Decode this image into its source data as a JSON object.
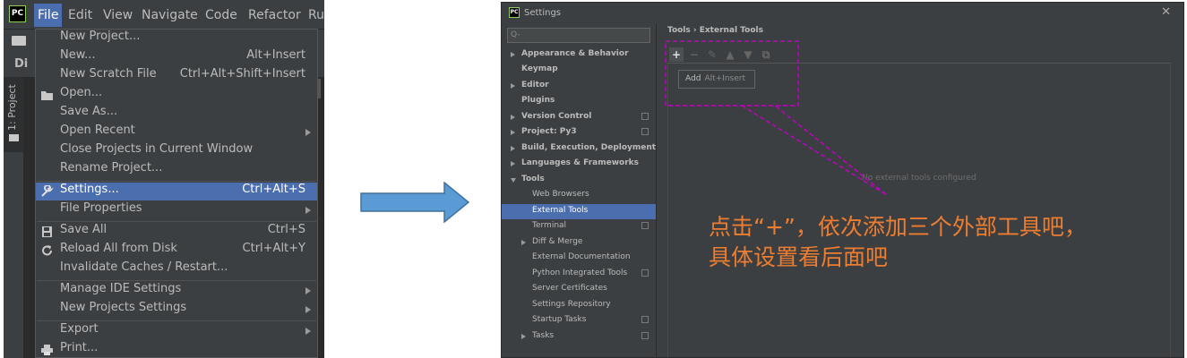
{
  "ide": {
    "logo": "PC",
    "menubar": [
      "File",
      "Edit",
      "View",
      "Navigate",
      "Code",
      "Refactor",
      "Ru"
    ],
    "project_crumb": "Di",
    "project_tab": "1: Project",
    "file_menu": [
      {
        "label": "New Project...",
        "shortcut": ""
      },
      {
        "label": "New...",
        "shortcut": "Alt+Insert"
      },
      {
        "label": "New Scratch File",
        "shortcut": "Ctrl+Alt+Shift+Insert"
      },
      {
        "label": "Open...",
        "shortcut": ""
      },
      {
        "label": "Save As...",
        "shortcut": ""
      },
      {
        "label": "Open Recent",
        "shortcut": ""
      },
      {
        "label": "Close Projects in Current Window",
        "shortcut": ""
      },
      {
        "label": "Rename Project...",
        "shortcut": ""
      },
      {
        "label": "Settings...",
        "shortcut": "Ctrl+Alt+S"
      },
      {
        "label": "File Properties",
        "shortcut": ""
      },
      {
        "label": "Save All",
        "shortcut": "Ctrl+S"
      },
      {
        "label": "Reload All from Disk",
        "shortcut": "Ctrl+Alt+Y"
      },
      {
        "label": "Invalidate Caches / Restart...",
        "shortcut": ""
      },
      {
        "label": "Manage IDE Settings",
        "shortcut": ""
      },
      {
        "label": "New Projects Settings",
        "shortcut": ""
      },
      {
        "label": "Export",
        "shortcut": ""
      },
      {
        "label": "Print...",
        "shortcut": ""
      }
    ],
    "selected_item": "Settings...",
    "accent": "#4b6eaf"
  },
  "settings": {
    "title": "Settings",
    "close": "✕",
    "search_placeholder": "Q-",
    "tree": [
      {
        "label": "Appearance & Behavior"
      },
      {
        "label": "Keymap"
      },
      {
        "label": "Editor"
      },
      {
        "label": "Plugins"
      },
      {
        "label": "Version Control"
      },
      {
        "label": "Project: Py3"
      },
      {
        "label": "Build, Execution, Deployment"
      },
      {
        "label": "Languages & Frameworks"
      },
      {
        "label": "Tools"
      },
      {
        "label": "Web Browsers"
      },
      {
        "label": "External Tools"
      },
      {
        "label": "Terminal"
      },
      {
        "label": "Diff & Merge"
      },
      {
        "label": "External Documentation"
      },
      {
        "label": "Python Integrated Tools"
      },
      {
        "label": "Server Certificates"
      },
      {
        "label": "Settings Repository"
      },
      {
        "label": "Startup Tasks"
      },
      {
        "label": "Tasks"
      }
    ],
    "breadcrumb": "Tools  ›  External Tools",
    "toolbar": [
      "+",
      "−",
      "✎",
      "▲",
      "▼",
      "⧉"
    ],
    "add_tooltip": {
      "label": "Add",
      "shortcut": "Alt+Insert"
    },
    "empty_message": "No external tools configured",
    "annotation": "点击“+”，依次添加三个外部工具吧，具体设置看后面吧",
    "annotation_color": "#ed7d31",
    "dash_color": "#c000c0"
  },
  "arrow_color": "#5b9bd5"
}
